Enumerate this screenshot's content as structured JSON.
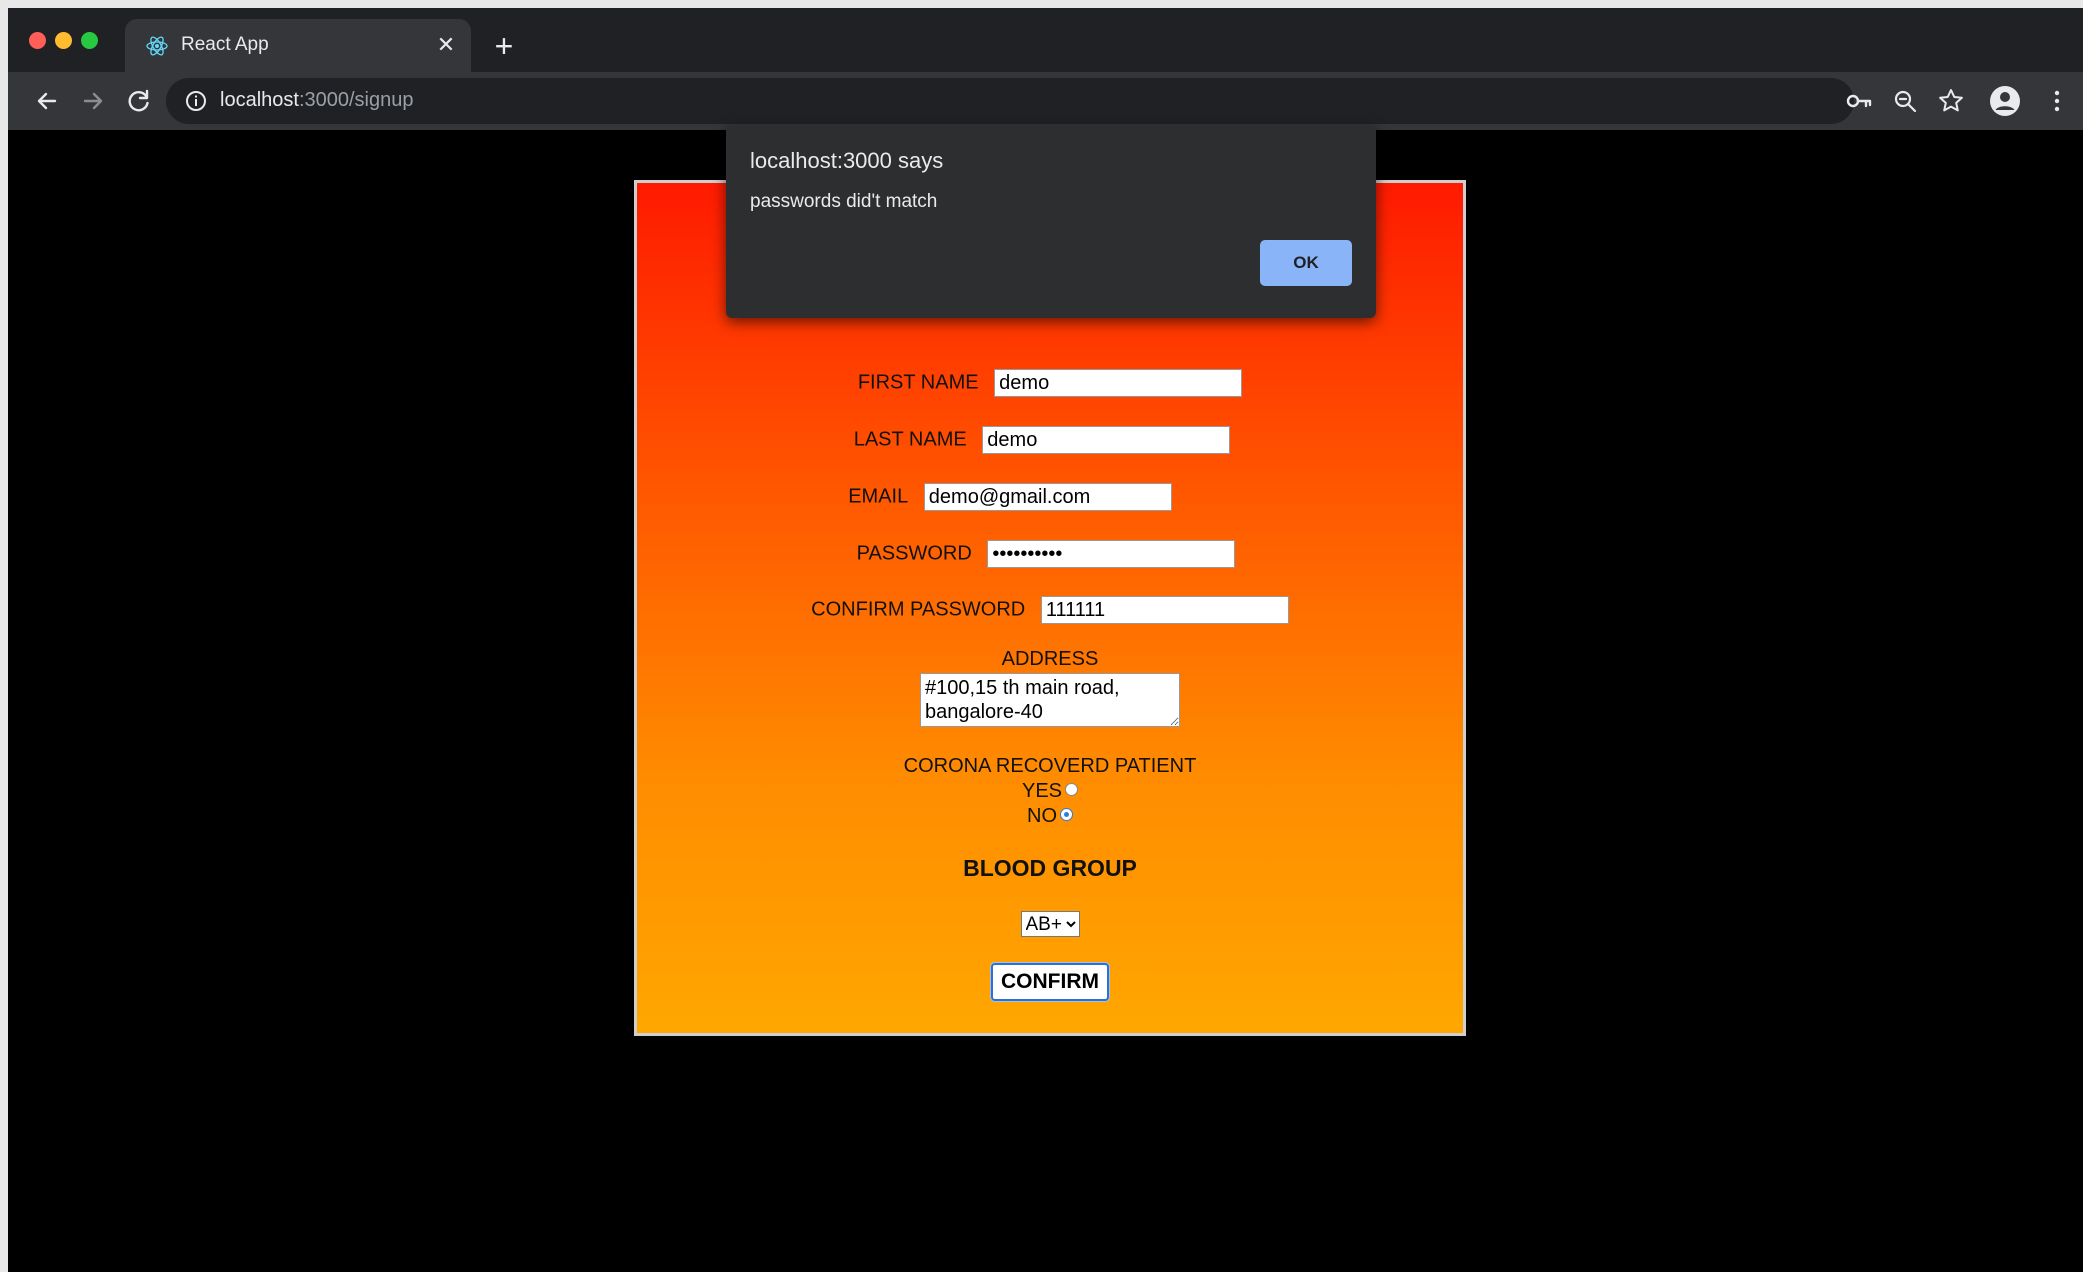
{
  "browser": {
    "tab_title": "React App",
    "tab_close": "✕",
    "new_tab": "+",
    "url_host": "localhost",
    "url_rest": ":3000/signup"
  },
  "alert": {
    "title": "localhost:3000 says",
    "message": "passwords did't match",
    "ok_label": "OK"
  },
  "form": {
    "first_name_label": "FIRST NAME",
    "first_name_value": "demo",
    "last_name_label": "LAST NAME",
    "last_name_value": "demo",
    "email_label": "EMAIL",
    "email_value": "demo@gmail.com",
    "password_label": "PASSWORD",
    "password_value": "••••••••••",
    "confirm_password_label": "CONFIRM PASSWORD",
    "confirm_password_value": "111111",
    "address_label": "ADDRESS",
    "address_value": "#100,15 th main road, bangalore-40",
    "corona_label": "CORONA RECOVERD PATIENT",
    "yes_label": "YES",
    "no_label": "NO",
    "blood_group_label": "BLOOD GROUP",
    "blood_group_selected": "AB+",
    "confirm_label": "CONFIRM"
  },
  "colors": {
    "gradient_top": "#ff1a00",
    "gradient_bottom": "#ffa700",
    "dialog_bg": "#2d2e30",
    "ok_button": "#8ab4f8"
  },
  "icons": [
    "react-icon",
    "close-icon",
    "plus-icon",
    "back-icon",
    "forward-icon",
    "reload-icon",
    "info-icon",
    "key-icon",
    "zoom-icon",
    "star-icon",
    "profile-icon",
    "menu-icon"
  ]
}
